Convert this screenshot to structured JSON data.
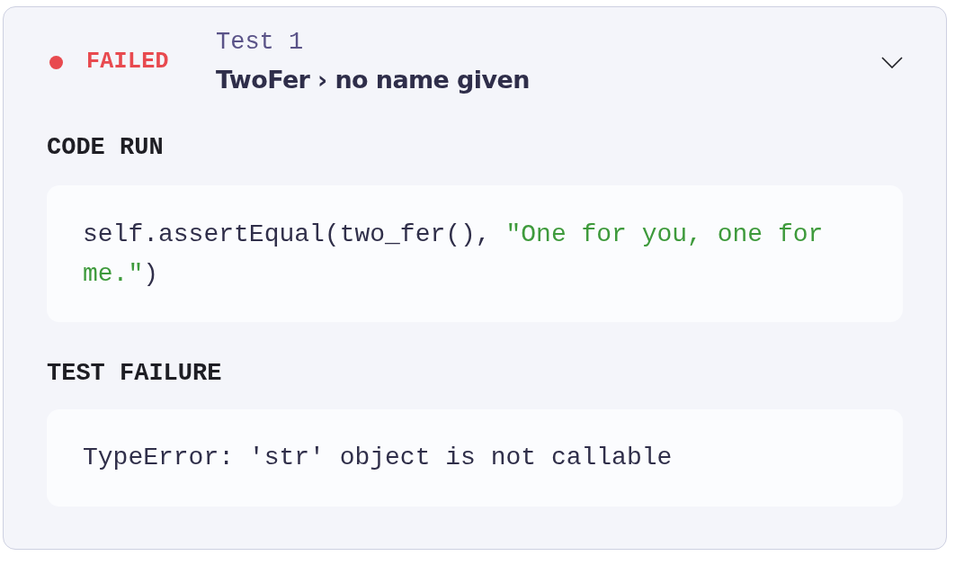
{
  "test": {
    "failed": true,
    "status_label": "FAILED",
    "number_label": "Test 1",
    "title": "TwoFer › no name given",
    "expanded": true
  },
  "sections": [
    {
      "kind": "code",
      "heading": "CODE RUN",
      "tokens": [
        {
          "kind": "plain",
          "text": "self.assertEqual(two_fer(), "
        },
        {
          "kind": "string",
          "text": "\"One for you, one for me.\""
        },
        {
          "kind": "plain",
          "text": ")"
        }
      ]
    },
    {
      "kind": "output",
      "heading": "TEST FAILURE",
      "text": "TypeError: 'str' object is not callable"
    }
  ]
}
